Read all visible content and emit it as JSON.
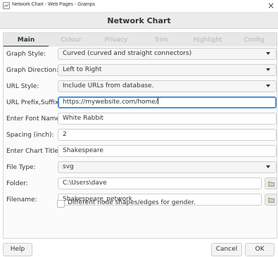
{
  "window": {
    "title": "Network Chart - Web Pages - Gramps",
    "close_symbol": "×"
  },
  "dialog": {
    "title": "Network Chart"
  },
  "tabs": [
    {
      "label": "Main",
      "active": true
    },
    {
      "label": "Colour",
      "active": false
    },
    {
      "label": "Privacy",
      "active": false
    },
    {
      "label": "Trim",
      "active": false
    },
    {
      "label": "Highlight",
      "active": false
    },
    {
      "label": "Config",
      "active": false
    }
  ],
  "form": {
    "graph_style": {
      "label": "Graph Style:",
      "value": "Curved (curved and straight connectors)"
    },
    "graph_direction": {
      "label": "Graph Direction:",
      "value": "Left to Right"
    },
    "url_style": {
      "label": "URL Style:",
      "value": "Include URLs from database."
    },
    "url_prefix": {
      "label": "URL Prefix,Suffix:",
      "value": "https://mywebsite.com/home/"
    },
    "font_name": {
      "label": "Enter Font Name:",
      "value": "White Rabbit"
    },
    "spacing": {
      "label": "Spacing (inch):",
      "value": "2"
    },
    "chart_title": {
      "label": "Enter Chart Title:",
      "value": "Shakespeare"
    },
    "file_type": {
      "label": "File Type:",
      "value": "svg"
    },
    "folder": {
      "label": "Folder:",
      "value": "C:\\Users\\dave"
    },
    "filename": {
      "label": "Filename:",
      "value": "Shakespeare_network"
    },
    "gender_shapes": {
      "label": "Different node shapes/edges for gender.",
      "checked": false
    }
  },
  "buttons": {
    "help": "Help",
    "cancel": "Cancel",
    "ok": "OK"
  },
  "colors": {
    "focus": "#4a90d9",
    "header_bg": "#ebebeb",
    "inactive_tab_text": "#b6b6b6"
  }
}
